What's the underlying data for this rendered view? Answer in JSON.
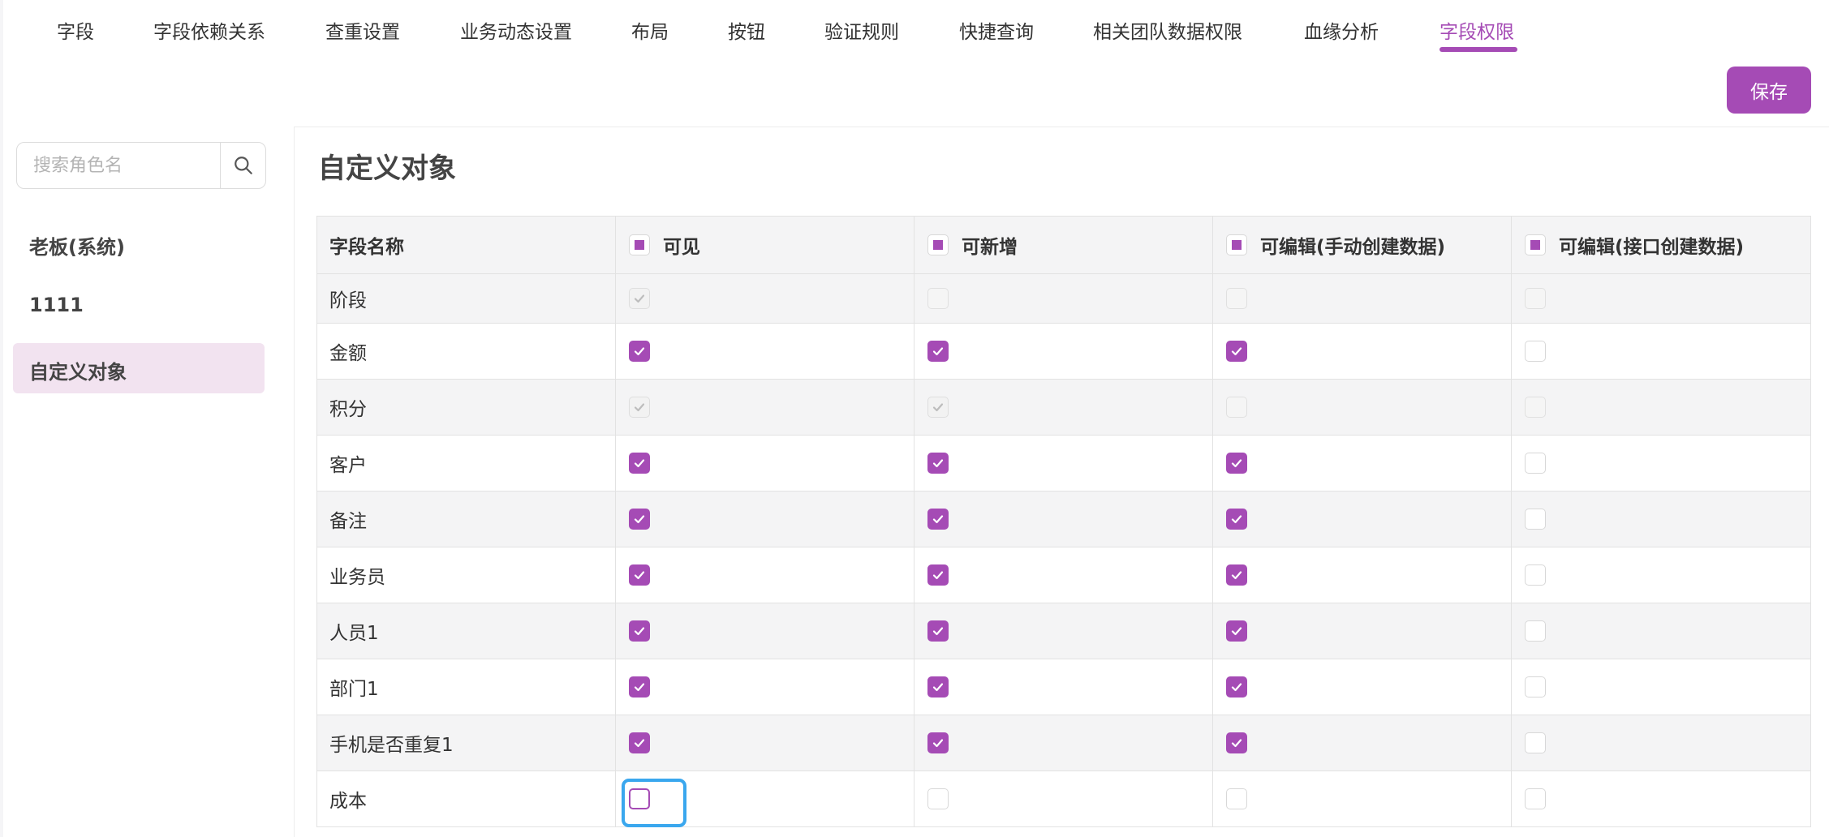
{
  "tabs": [
    {
      "label": "字段"
    },
    {
      "label": "字段依赖关系"
    },
    {
      "label": "查重设置"
    },
    {
      "label": "业务动态设置"
    },
    {
      "label": "布局"
    },
    {
      "label": "按钮"
    },
    {
      "label": "验证规则"
    },
    {
      "label": "快捷查询"
    },
    {
      "label": "相关团队数据权限"
    },
    {
      "label": "血缘分析"
    },
    {
      "label": "字段权限",
      "active": true
    }
  ],
  "toolbar": {
    "save_label": "保存"
  },
  "sidebar": {
    "search_placeholder": "搜索角色名",
    "roles": [
      {
        "label": "老板(系统)"
      },
      {
        "label": "1111"
      },
      {
        "label": "自定义对象",
        "active": true
      }
    ]
  },
  "main": {
    "title": "自定义对象",
    "columns": [
      {
        "label": "字段名称"
      },
      {
        "label": "可见",
        "header_state": "indeterminate"
      },
      {
        "label": "可新增",
        "header_state": "indeterminate"
      },
      {
        "label": "可编辑(手动创建数据)",
        "header_state": "indeterminate"
      },
      {
        "label": "可编辑(接口创建数据)",
        "header_state": "indeterminate"
      }
    ],
    "rows": [
      {
        "name": "阶段",
        "perms": [
          "disabled-checked",
          "disabled",
          "disabled",
          "disabled"
        ]
      },
      {
        "name": "金额",
        "perms": [
          "checked",
          "checked",
          "checked",
          "unchecked"
        ]
      },
      {
        "name": "积分",
        "perms": [
          "disabled-checked",
          "disabled-checked",
          "disabled",
          "disabled"
        ]
      },
      {
        "name": "客户",
        "perms": [
          "checked",
          "checked",
          "checked",
          "unchecked"
        ]
      },
      {
        "name": "备注",
        "perms": [
          "checked",
          "checked",
          "checked",
          "unchecked"
        ]
      },
      {
        "name": "业务员",
        "perms": [
          "checked",
          "checked",
          "checked",
          "unchecked"
        ]
      },
      {
        "name": "人员1",
        "perms": [
          "checked",
          "checked",
          "checked",
          "unchecked"
        ]
      },
      {
        "name": "部门1",
        "perms": [
          "checked",
          "checked",
          "checked",
          "unchecked"
        ]
      },
      {
        "name": "手机是否重复1",
        "perms": [
          "checked",
          "checked",
          "checked",
          "unchecked"
        ]
      },
      {
        "name": "成本",
        "perms": [
          "focused-unchecked",
          "unchecked",
          "unchecked",
          "unchecked"
        ]
      }
    ]
  },
  "colors": {
    "accent": "#a54bb5",
    "focus_ring": "#3aa7ee",
    "active_role_bg": "#f2e3f0"
  }
}
